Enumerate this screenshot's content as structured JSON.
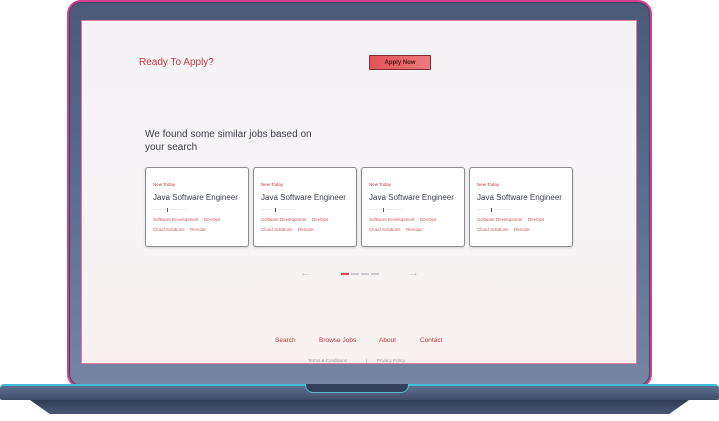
{
  "apply_section": {
    "title": "Ready To Apply?",
    "button_label": "Apply Now"
  },
  "similar": {
    "heading": "We found some similar jobs based on your search",
    "cards": [
      {
        "tag": "New Today",
        "title": "Java Software Engineer",
        "skills_line1": [
          "Software Development",
          "DevOps"
        ],
        "skills_line2": [
          "Cloud Solutions",
          "Remote"
        ]
      },
      {
        "tag": "New Today",
        "title": "Java Software Engineer",
        "skills_line1": [
          "Software Development",
          "DevOps"
        ],
        "skills_line2": [
          "Cloud Solutions",
          "Remote"
        ]
      },
      {
        "tag": "New Today",
        "title": "Java Software Engineer",
        "skills_line1": [
          "Software Development",
          "DevOps"
        ],
        "skills_line2": [
          "Cloud Solutions",
          "Remote"
        ]
      },
      {
        "tag": "New Today",
        "title": "Java Software Engineer",
        "skills_line1": [
          "Software Development",
          "DevOps"
        ],
        "skills_line2": [
          "Cloud Solutions",
          "Remote"
        ]
      }
    ],
    "prev_arrow": "←",
    "next_arrow": "→",
    "pager_current": 1,
    "pager_total": 4
  },
  "footer": {
    "nav": [
      "Search",
      "Browse Jobs",
      "About",
      "Contact"
    ],
    "legal": [
      "Terms & Conditions",
      "|",
      "Privacy Policy"
    ]
  },
  "colors": {
    "accent": "#c0393f",
    "button": "#e25458",
    "frame_accent": "#d63d93",
    "hinge_accent": "#3fc0d8"
  }
}
